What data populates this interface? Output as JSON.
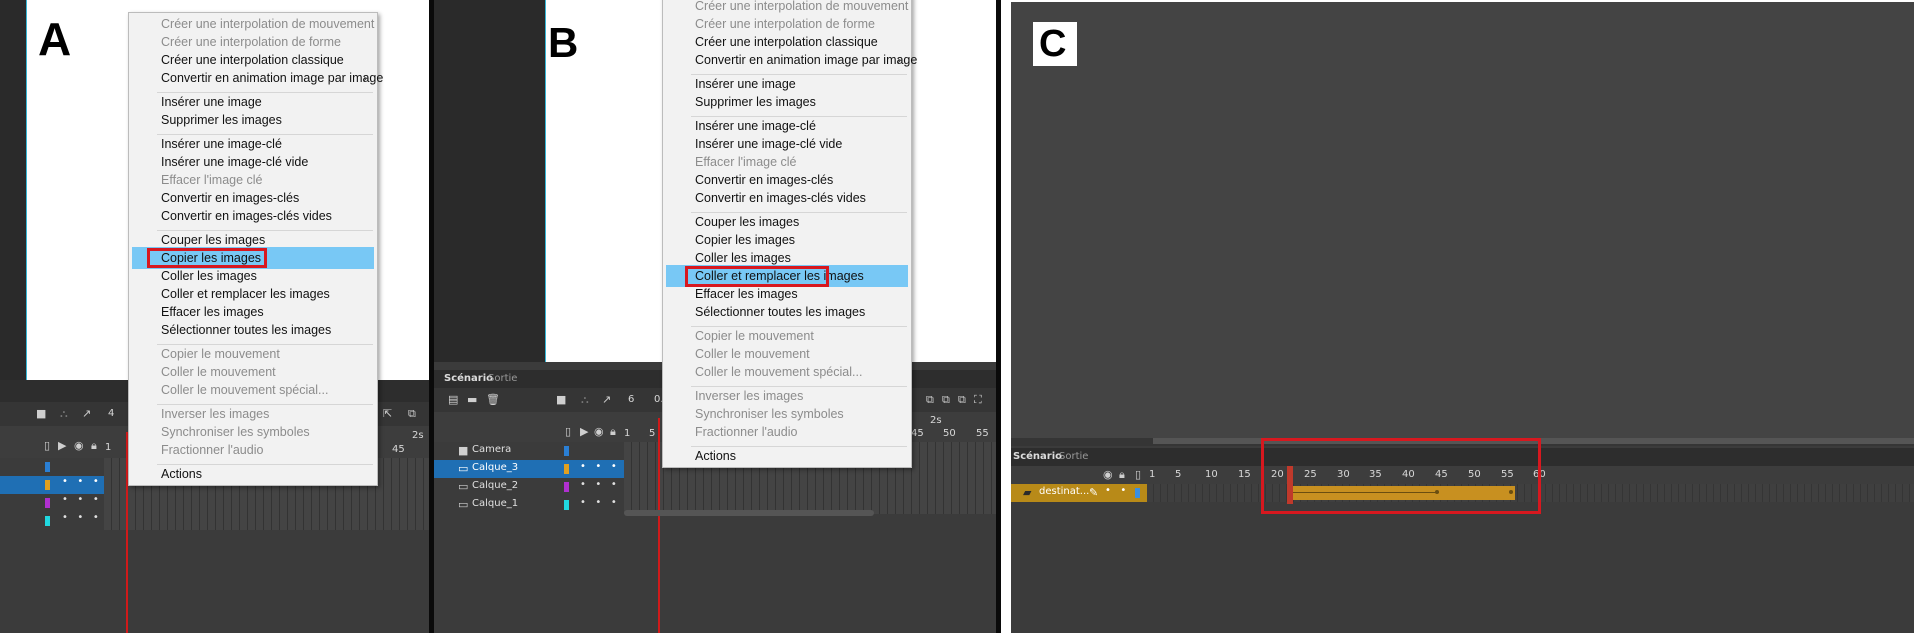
{
  "panels": {
    "a": {
      "letter": "A"
    },
    "b": {
      "letter": "B"
    },
    "c": {
      "letter": "C"
    }
  },
  "menu_a": {
    "items": [
      {
        "label": "Créer une interpolation de mouvement",
        "disabled": true
      },
      {
        "label": "Créer une interpolation de forme",
        "disabled": true
      },
      {
        "label": "Créer une interpolation classique",
        "disabled": false
      },
      {
        "label": "Convertir en animation image par image",
        "disabled": false,
        "submenu": "›"
      },
      {
        "label": "Insérer une image",
        "disabled": false
      },
      {
        "label": "Supprimer les images",
        "disabled": false
      },
      {
        "label": "Insérer une image-clé",
        "disabled": false
      },
      {
        "label": "Insérer une image-clé vide",
        "disabled": false
      },
      {
        "label": "Effacer l'image clé",
        "disabled": true
      },
      {
        "label": "Convertir en images-clés",
        "disabled": false
      },
      {
        "label": "Convertir en images-clés vides",
        "disabled": false
      },
      {
        "label": "Couper les images",
        "disabled": false
      },
      {
        "label": "Copier les images",
        "disabled": false,
        "highlighted": true
      },
      {
        "label": "Coller les images",
        "disabled": false
      },
      {
        "label": "Coller et remplacer les images",
        "disabled": false
      },
      {
        "label": "Effacer les images",
        "disabled": false
      },
      {
        "label": "Sélectionner toutes les images",
        "disabled": false
      },
      {
        "label": "Copier le mouvement",
        "disabled": true
      },
      {
        "label": "Coller le mouvement",
        "disabled": true
      },
      {
        "label": "Coller le mouvement spécial...",
        "disabled": true
      },
      {
        "label": "Inverser les images",
        "disabled": true
      },
      {
        "label": "Synchroniser les symboles",
        "disabled": true
      },
      {
        "label": "Fractionner l'audio",
        "disabled": true
      },
      {
        "label": "Actions",
        "disabled": false
      }
    ]
  },
  "menu_b": {
    "items": [
      {
        "label": "Créer une interpolation de mouvement",
        "disabled": true
      },
      {
        "label": "Créer une interpolation de forme",
        "disabled": true
      },
      {
        "label": "Créer une interpolation classique",
        "disabled": false
      },
      {
        "label": "Convertir en animation image par image",
        "disabled": false,
        "submenu": "›"
      },
      {
        "label": "Insérer une image",
        "disabled": false
      },
      {
        "label": "Supprimer les images",
        "disabled": false
      },
      {
        "label": "Insérer une image-clé",
        "disabled": false
      },
      {
        "label": "Insérer une image-clé vide",
        "disabled": false
      },
      {
        "label": "Effacer l'image clé",
        "disabled": true
      },
      {
        "label": "Convertir en images-clés",
        "disabled": false
      },
      {
        "label": "Convertir en images-clés vides",
        "disabled": false
      },
      {
        "label": "Couper les images",
        "disabled": false
      },
      {
        "label": "Copier les images",
        "disabled": false
      },
      {
        "label": "Coller les images",
        "disabled": false
      },
      {
        "label": "Coller et remplacer les images",
        "disabled": false,
        "highlighted": true
      },
      {
        "label": "Effacer les images",
        "disabled": false
      },
      {
        "label": "Sélectionner toutes les images",
        "disabled": false
      },
      {
        "label": "Copier le mouvement",
        "disabled": true
      },
      {
        "label": "Coller le mouvement",
        "disabled": true
      },
      {
        "label": "Coller le mouvement spécial...",
        "disabled": true
      },
      {
        "label": "Inverser les images",
        "disabled": true
      },
      {
        "label": "Synchroniser les symboles",
        "disabled": true
      },
      {
        "label": "Fractionner l'audio",
        "disabled": true
      },
      {
        "label": "Actions",
        "disabled": false
      }
    ]
  },
  "timeline_a": {
    "ruler_labels": [
      "4",
      "1",
      "2s",
      "45"
    ],
    "layer_colors": [
      "#2a7fd4",
      "#e0a020",
      "#b030d0",
      "#20d8e0"
    ]
  },
  "timeline_b": {
    "tabs": [
      "Scénario",
      "Sortie"
    ],
    "ruler_top": [
      "6",
      "0.",
      "2s"
    ],
    "ruler_nums": [
      "1",
      "5",
      "45",
      "50",
      "55"
    ],
    "layers": [
      {
        "name": "Camera",
        "color": "#2a7fd4",
        "selected": false
      },
      {
        "name": "Calque_3",
        "color": "#e0a020",
        "selected": true
      },
      {
        "name": "Calque_2",
        "color": "#b030d0",
        "selected": false
      },
      {
        "name": "Calque_1",
        "color": "#20d8e0",
        "selected": false
      }
    ]
  },
  "timeline_c": {
    "tabs": [
      "Scénario",
      "Sortie"
    ],
    "ruler_nums": [
      "1",
      "5",
      "10",
      "15",
      "20",
      "25",
      "30",
      "35",
      "40",
      "45",
      "50",
      "55",
      "60"
    ],
    "layer_name": "destinat...",
    "layer_color": "#d4a020",
    "tween_color": "#c89020"
  },
  "icons": {
    "camera": "camera-icon",
    "eye": "eye-icon",
    "lock": "lock-icon",
    "outline": "outline-icon",
    "new_layer": "new-layer-icon",
    "folder": "folder-icon",
    "trash": "trash-icon",
    "pencil": "pencil-icon"
  }
}
